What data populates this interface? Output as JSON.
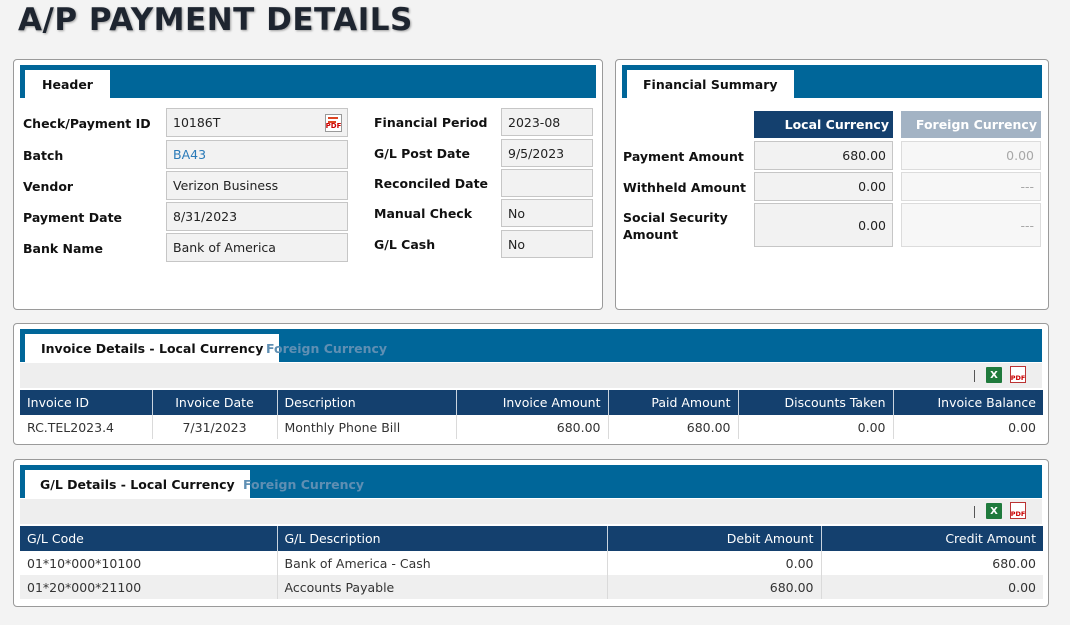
{
  "page": {
    "title": "A/P PAYMENT DETAILS"
  },
  "header_panel": {
    "tab_label": "Header",
    "left_fields": [
      {
        "label": "Check/Payment ID",
        "value": "10186T"
      },
      {
        "label": "Batch",
        "value": "BA43"
      },
      {
        "label": "Vendor",
        "value": "Verizon Business"
      },
      {
        "label": "Payment Date",
        "value": "8/31/2023"
      },
      {
        "label": "Bank Name",
        "value": "Bank of America"
      }
    ],
    "right_fields": [
      {
        "label": "Financial Period",
        "value": "2023-08"
      },
      {
        "label": "G/L Post Date",
        "value": "9/5/2023"
      },
      {
        "label": "Reconciled Date",
        "value": ""
      },
      {
        "label": "Manual Check",
        "value": "No"
      },
      {
        "label": "G/L Cash",
        "value": "No"
      }
    ],
    "pdf_icon_text": "PDF"
  },
  "financial_summary": {
    "tab_label": "Financial Summary",
    "local_header": "Local Currency",
    "foreign_header": "Foreign Currency",
    "rows": [
      {
        "label": "Payment Amount",
        "local": "680.00",
        "foreign": "0.00"
      },
      {
        "label": "Withheld Amount",
        "local": "0.00",
        "foreign": "---"
      },
      {
        "label_line1": "Social Security",
        "label_line2": "Amount",
        "local": "0.00",
        "foreign": "---"
      }
    ]
  },
  "invoice_details": {
    "tab_active": "Invoice Details - Local Currency",
    "tab_inactive": "Foreign Currency",
    "excel_icon_text": "X",
    "pdf_icon_text": "PDF",
    "columns": [
      "Invoice ID",
      "Invoice Date",
      "Description",
      "Invoice Amount",
      "Paid Amount",
      "Discounts Taken",
      "Invoice Balance"
    ],
    "rows": [
      [
        "RC.TEL2023.4",
        "7/31/2023",
        "Monthly Phone Bill",
        "680.00",
        "680.00",
        "0.00",
        "0.00"
      ]
    ]
  },
  "gl_details": {
    "tab_active": "G/L Details - Local Currency",
    "tab_inactive": "Foreign Currency",
    "excel_icon_text": "X",
    "pdf_icon_text": "PDF",
    "columns": [
      "G/L Code",
      "G/L Description",
      "Debit Amount",
      "Credit Amount"
    ],
    "rows": [
      [
        "01*10*000*10100",
        "Bank of America - Cash",
        "0.00",
        "680.00"
      ],
      [
        "01*20*000*21100",
        "Accounts Payable",
        "680.00",
        "0.00"
      ]
    ]
  },
  "colors": {
    "tab_bar": "#006699",
    "table_header": "#14406e",
    "local_currency_header": "#14406e",
    "foreign_currency_header": "#a3b3c4",
    "link": "#2a7ab8",
    "inactive_tab_text": "#5f8fb3"
  }
}
